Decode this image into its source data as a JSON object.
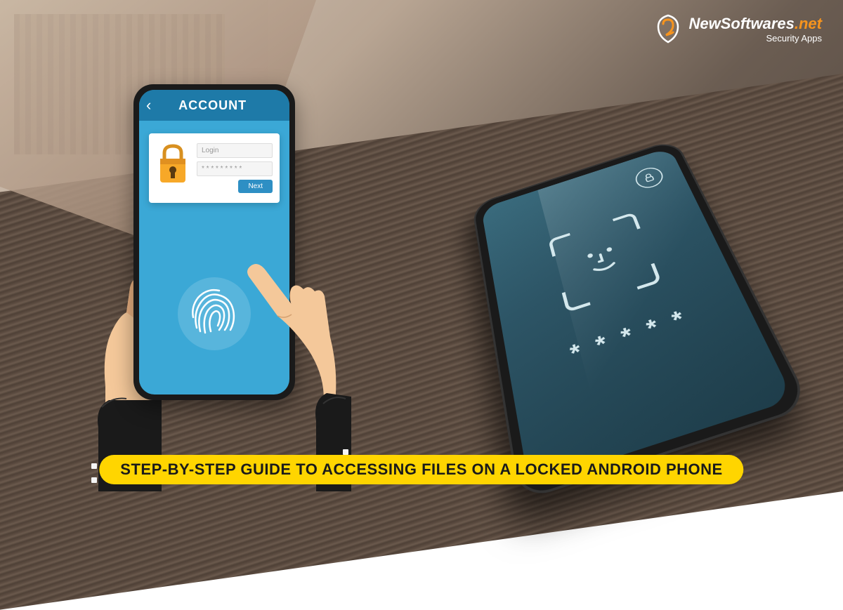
{
  "logo": {
    "brand_part1": "NewSoftwares",
    "brand_part2": ".net",
    "tagline": "Security Apps"
  },
  "illustrated_phone": {
    "header_title": "ACCOUNT",
    "login_label": "Login",
    "password_mask": "* * * * * * * * *",
    "button_label": "Next"
  },
  "real_phone": {
    "password_dots_count": 5
  },
  "banner": {
    "text": "STEP-BY-STEP GUIDE TO ACCESSING FILES ON A LOCKED ANDROID PHONE"
  },
  "colors": {
    "banner_bg": "#ffd500",
    "accent_orange": "#f7941d",
    "phone_screen_blue": "#3ba8d6"
  }
}
